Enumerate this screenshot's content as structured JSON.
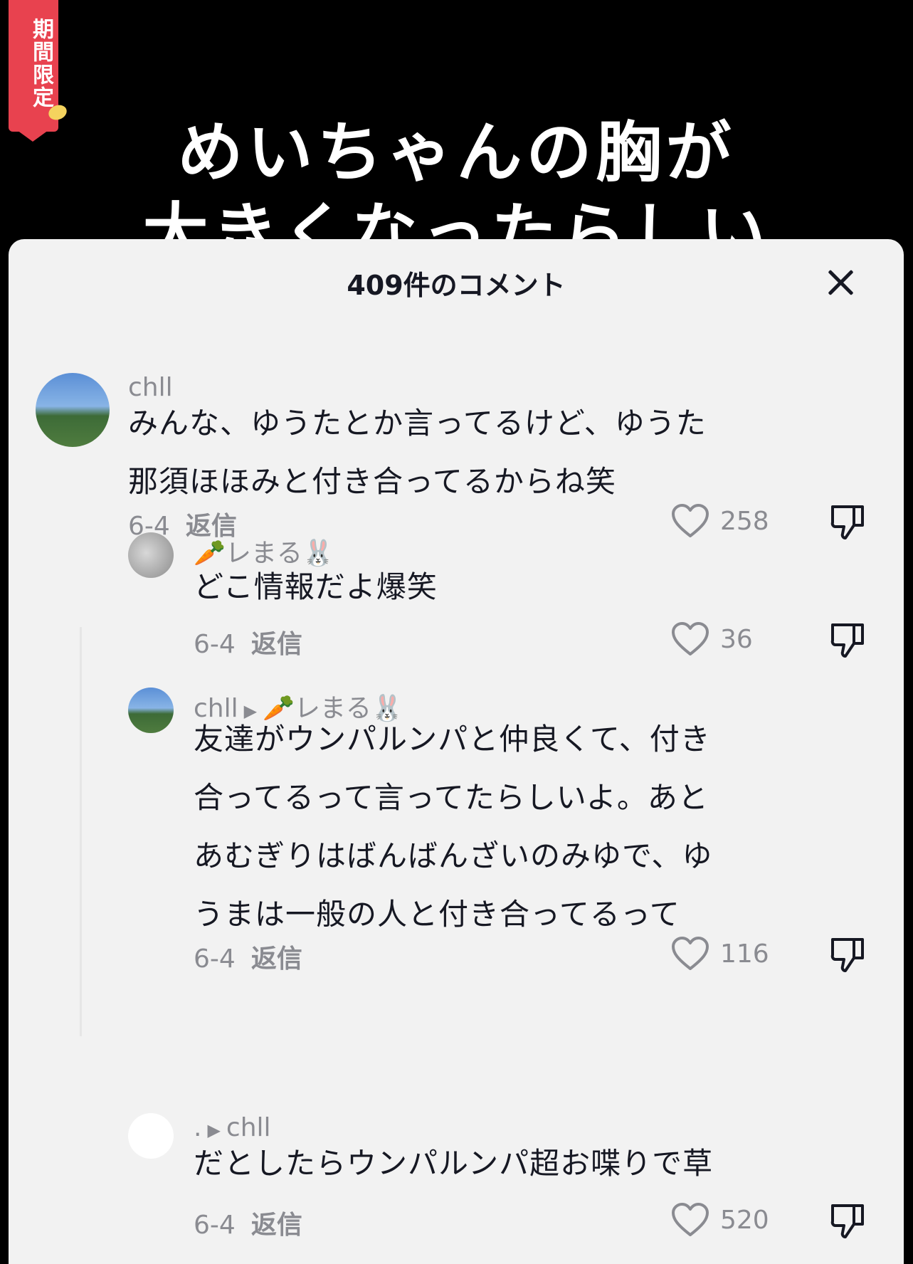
{
  "video": {
    "badge": "期間限定",
    "caption_line1": "めいちゃんの胸が",
    "caption_line2": "大きくなったらしい"
  },
  "sheet": {
    "title": "409件のコメント"
  },
  "comments": [
    {
      "username": "chll",
      "text_line1": "みんな、ゆうたとか言ってるけど、ゆうた",
      "text_line2": "那須ほほみと付き合ってるからね笑",
      "date": "6-4",
      "reply_label": "返信",
      "likes": "258"
    },
    {
      "username": "🥕レまる🐰",
      "text": "どこ情報だよ爆笑",
      "date": "6-4",
      "reply_label": "返信",
      "likes": "36"
    },
    {
      "username": "chll",
      "reply_to": "🥕レまる🐰",
      "text_line1": "友達がウンパルンパと仲良くて、付き",
      "text_line2": "合ってるって言ってたらしいよ。あと",
      "text_line3": "あむぎりはばんばんざいのみゆで、ゆ",
      "text_line4": "うまは一般の人と付き合ってるって",
      "date": "6-4",
      "reply_label": "返信",
      "likes": "116"
    },
    {
      "username": ".",
      "reply_to": "chll",
      "text": "だとしたらウンパルンパ超お喋りで草",
      "date": "6-4",
      "reply_label": "返信",
      "likes": "520"
    }
  ],
  "icons": {
    "like": "heart-outline-icon",
    "dislike": "thumbs-down-icon",
    "close": "close-icon",
    "reply_arrow": "play-arrow-icon"
  },
  "colors": {
    "sheet_bg": "#f2f2f2",
    "badge_red": "#e8424f",
    "text_primary": "#161823",
    "text_secondary": "#8a8b91"
  }
}
